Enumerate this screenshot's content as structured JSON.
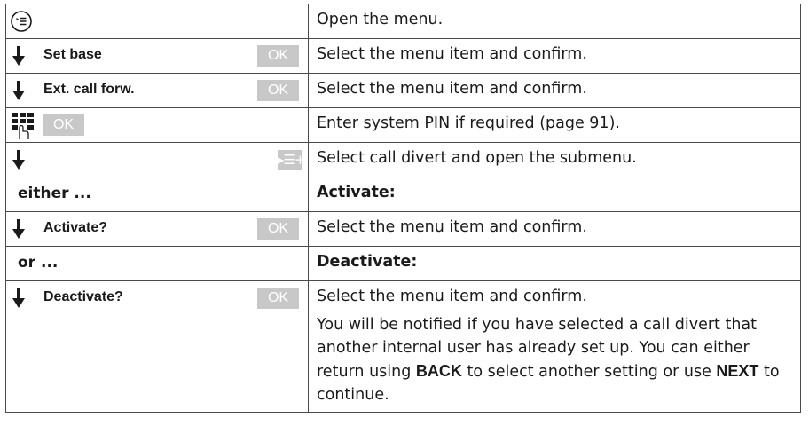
{
  "rows": [
    {
      "icon": "menu-key-icon",
      "text": "Open the menu."
    },
    {
      "icon": "down-arrow-icon",
      "label": "Set base",
      "key": "OK",
      "text": "Select the menu item and confirm."
    },
    {
      "icon": "down-arrow-icon",
      "label": "Ext. call forw.",
      "key": "OK",
      "text": "Select the menu item and confirm."
    },
    {
      "icon": "keypad-icon",
      "key": "OK",
      "text": "Enter system PIN if required (page 91)."
    },
    {
      "icon": "down-arrow-icon",
      "key_icon": "submenu-key-icon",
      "key": "▸☰+",
      "text": "Select call divert and open the submenu."
    },
    {
      "label": "either ...",
      "text": "Activate:"
    },
    {
      "icon": "down-arrow-icon",
      "label": "Activate?",
      "key": "OK",
      "text": "Select the menu item and confirm."
    },
    {
      "label": "or ...",
      "text": "Deactivate:"
    },
    {
      "icon": "down-arrow-icon",
      "label": "Deactivate?",
      "key": "OK",
      "text": "Select the menu item and confirm."
    }
  ],
  "note": {
    "part1": "You will be notified if you have selected a call divert that another internal user has already set up. You can either return using ",
    "kw1": "BACK",
    "part2": " to select another setting or use ",
    "kw2": "NEXT",
    "part3": " to continue."
  },
  "colors": {
    "softkey": "#c8c8c8",
    "border": "#4a4a4a",
    "text": "#1a1a1a"
  }
}
